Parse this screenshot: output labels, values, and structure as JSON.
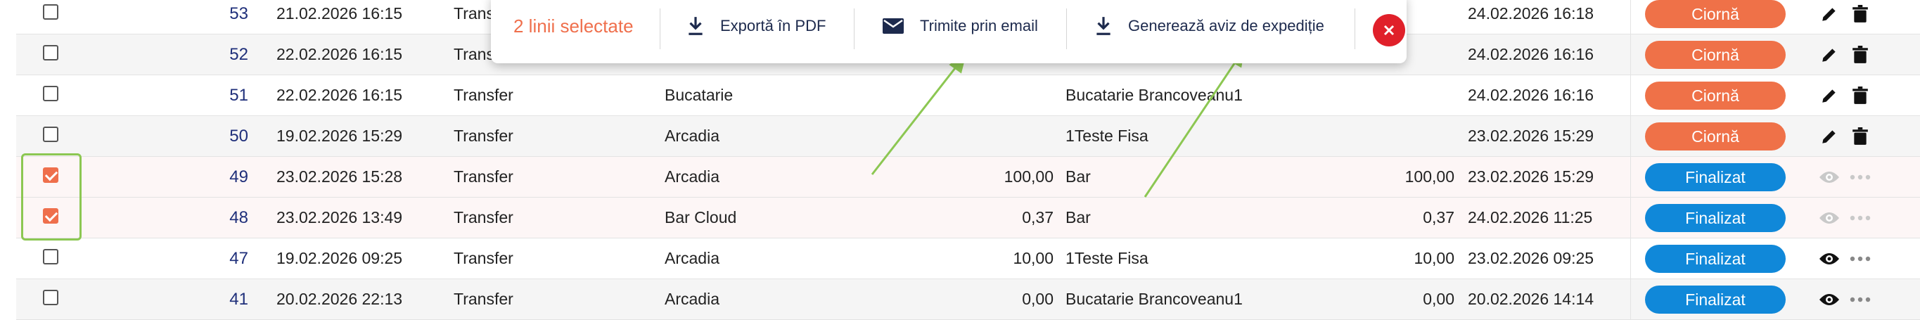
{
  "toolbar": {
    "selected_count": "2 linii selectate",
    "export_pdf": "Exportă în PDF",
    "send_email": "Trimite prin email",
    "generate_notice": "Generează aviz de expediție",
    "icons": [
      "download-icon",
      "email-icon",
      "download-icon",
      "close-icon"
    ]
  },
  "status_colors": {
    "Ciornă": "#ef7148",
    "Finalizat": "#1088d9",
    "accent": "#ef6f4c",
    "annotation": "#8cc752"
  },
  "rows": [
    {
      "checked": false,
      "id": "53",
      "date": "21.02.2026 16:15",
      "type": "Transfer",
      "from": "",
      "qty1": "",
      "to": "",
      "qty2": "",
      "date2": "24.02.2026 16:18",
      "status": "Ciornă"
    },
    {
      "checked": false,
      "id": "52",
      "date": "22.02.2026 16:15",
      "type": "Transfer",
      "from": "",
      "qty1": "",
      "to": "",
      "qty2": "",
      "date2": "24.02.2026 16:16",
      "status": "Ciornă"
    },
    {
      "checked": false,
      "id": "51",
      "date": "22.02.2026 16:15",
      "type": "Transfer",
      "from": "Bucatarie",
      "qty1": "",
      "to": "Bucatarie Brancoveanu1",
      "qty2": "",
      "date2": "24.02.2026 16:16",
      "status": "Ciornă"
    },
    {
      "checked": false,
      "id": "50",
      "date": "19.02.2026 15:29",
      "type": "Transfer",
      "from": "Arcadia",
      "qty1": "",
      "to": "1Teste Fisa",
      "qty2": "",
      "date2": "23.02.2026 15:29",
      "status": "Ciornă"
    },
    {
      "checked": true,
      "id": "49",
      "date": "23.02.2026 15:28",
      "type": "Transfer",
      "from": "Arcadia",
      "qty1": "100,00",
      "to": "Bar",
      "qty2": "100,00",
      "date2": "23.02.2026 15:29",
      "status": "Finalizat"
    },
    {
      "checked": true,
      "id": "48",
      "date": "23.02.2026 13:49",
      "type": "Transfer",
      "from": "Bar Cloud",
      "qty1": "0,37",
      "to": "Bar",
      "qty2": "0,37",
      "date2": "24.02.2026 11:25",
      "status": "Finalizat"
    },
    {
      "checked": false,
      "id": "47",
      "date": "19.02.2026 09:25",
      "type": "Transfer",
      "from": "Arcadia",
      "qty1": "10,00",
      "to": "1Teste Fisa",
      "qty2": "10,00",
      "date2": "23.02.2026 09:25",
      "status": "Finalizat"
    },
    {
      "checked": false,
      "id": "41",
      "date": "20.02.2026 22:13",
      "type": "Transfer",
      "from": "Arcadia",
      "qty1": "0,00",
      "to": "Bucatarie Brancoveanu1",
      "qty2": "0,00",
      "date2": "20.02.2026 14:14",
      "status": "Finalizat"
    }
  ]
}
